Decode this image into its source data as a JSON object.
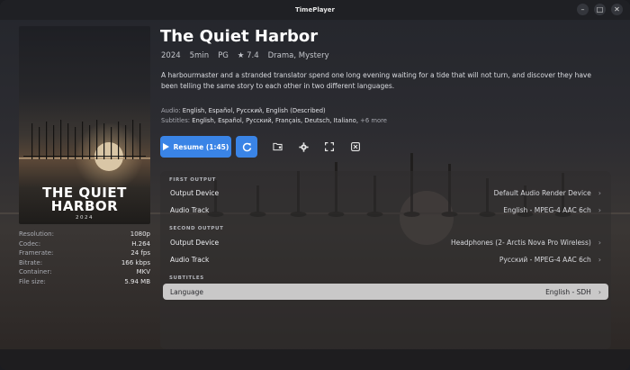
{
  "window": {
    "title": "TimePlayer"
  },
  "movie": {
    "title": "The Quiet Harbor",
    "year": "2024",
    "runtime": "5min",
    "rating": "PG",
    "score": "★ 7.4",
    "genres": "Drama, Mystery",
    "description": "A harbourmaster and a stranded translator spend one long evening waiting for a tide that will not turn, and discover they have been telling the same story to each other in two different languages.",
    "audio_label": "Audio:",
    "audio_value": "English, Español, Русский, English (Described)",
    "subs_label": "Subtitles:",
    "subs_value": "English, Español, Русский, Français, Deutsch, Italiano,",
    "subs_more": "+6 more"
  },
  "poster": {
    "title_line1": "THE QUIET",
    "title_line2": "HARBOR",
    "year": "2024"
  },
  "specs": [
    {
      "key": "Resolution:",
      "value": "1080p"
    },
    {
      "key": "Codec:",
      "value": "H.264"
    },
    {
      "key": "Framerate:",
      "value": "24 fps"
    },
    {
      "key": "Bitrate:",
      "value": "166 kbps"
    },
    {
      "key": "Container:",
      "value": "MKV"
    },
    {
      "key": "File size:",
      "value": "5.94 MB"
    }
  ],
  "actions": {
    "resume_label": "Resume (1:45)"
  },
  "output": {
    "first_header": "FIRST OUTPUT",
    "first_device_label": "Output Device",
    "first_device_value": "Default Audio Render Device",
    "first_track_label": "Audio Track",
    "first_track_value": "English - MPEG-4 AAC 6ch",
    "second_header": "SECOND OUTPUT",
    "second_device_label": "Output Device",
    "second_device_value": "Headphones (2- Arctis Nova Pro Wireless)",
    "second_track_label": "Audio Track",
    "second_track_value": "Русский - MPEG-4 AAC 6ch",
    "subs_header": "SUBTITLES",
    "subs_label": "Language",
    "subs_value": "English - SDH"
  },
  "colors": {
    "accent": "#3a84e6",
    "selected_row": "#c9c8c8"
  }
}
